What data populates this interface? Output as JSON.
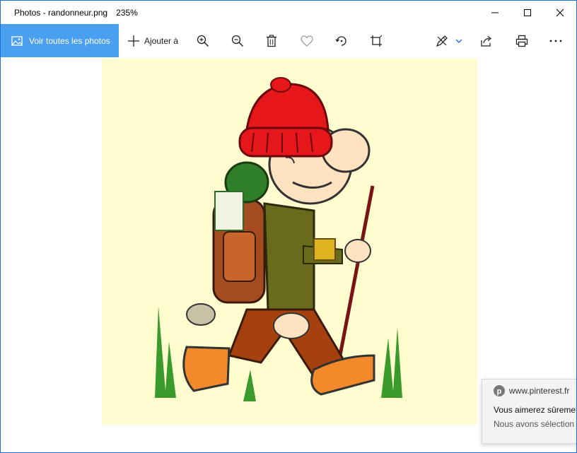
{
  "window": {
    "title": "Photos - randonneur.png",
    "zoom_level": "235%",
    "accent_color": "#4aa0ef",
    "border_color": "#1f6fd6"
  },
  "window_controls": [
    "minimize-icon",
    "maximize-icon",
    "close-icon"
  ],
  "toolbar": {
    "view_all_label": "Voir toutes les photos",
    "add_to_label": "Ajouter à",
    "icons": [
      "gallery-icon",
      "plus-icon",
      "zoom-in-icon",
      "zoom-out-icon",
      "delete-icon",
      "favorite-heart-icon",
      "rotate-icon",
      "crop-icon",
      "edit-draw-icon",
      "chevron-down-icon",
      "share-icon",
      "print-icon",
      "more-icon"
    ]
  },
  "photo": {
    "file_name": "randonneur.png",
    "background_color": "#fffdd0",
    "subject": "hiker-illustration"
  },
  "notification": {
    "site": "www.pinterest.fr",
    "line1": "Vous aimerez sûreme",
    "line2": "Nous avons sélection",
    "icon": "pinterest-icon"
  }
}
